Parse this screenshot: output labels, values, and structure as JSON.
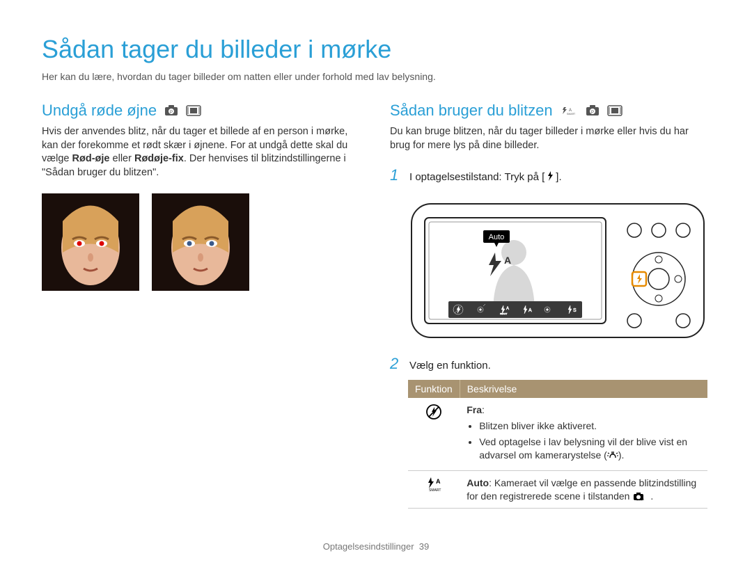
{
  "page_title": "Sådan tager du billeder i mørke",
  "page_intro": "Her kan du lære, hvordan du tager billeder om natten eller under forhold med lav belysning.",
  "left": {
    "title": "Undgå røde øjne",
    "body_pre": "Hvis der anvendes blitz, når du tager et billede af en person i mørke, kan der forekomme et rødt skær i øjnene. For at undgå dette skal du vælge ",
    "bold1": "Rød-øje",
    "body_mid": " eller ",
    "bold2": "Rødøje-fix",
    "body_post": ". Der henvises til blitzindstillingerne i \"Sådan bruger du blitzen\"."
  },
  "right": {
    "title": "Sådan bruger du blitzen",
    "intro": "Du kan bruge blitzen, når du tager billeder i mørke eller hvis du har brug for mere lys på dine billeder.",
    "step1_num": "1",
    "step1_pre": "I optagelsestilstand: Tryk på [",
    "step1_post": "].",
    "camera_auto_label": "Auto",
    "step2_num": "2",
    "step2_text": "Vælg en funktion.",
    "table": {
      "head_func": "Funktion",
      "head_desc": "Beskrivelse",
      "row1_label": "Fra",
      "row1_colon": ":",
      "row1_b1": "Blitzen bliver ikke aktiveret.",
      "row1_b2_pre": "Ved optagelse i lav belysning vil der blive vist en advarsel om kamerarystelse (",
      "row1_b2_post": ").",
      "row2_label": "Auto",
      "row2_pre": ": Kameraet vil vælge en passende blitzindstilling for den registrerede scene i tilstanden ",
      "row2_post": "."
    }
  },
  "footer_section": "Optagelsesindstillinger",
  "footer_page": "39"
}
